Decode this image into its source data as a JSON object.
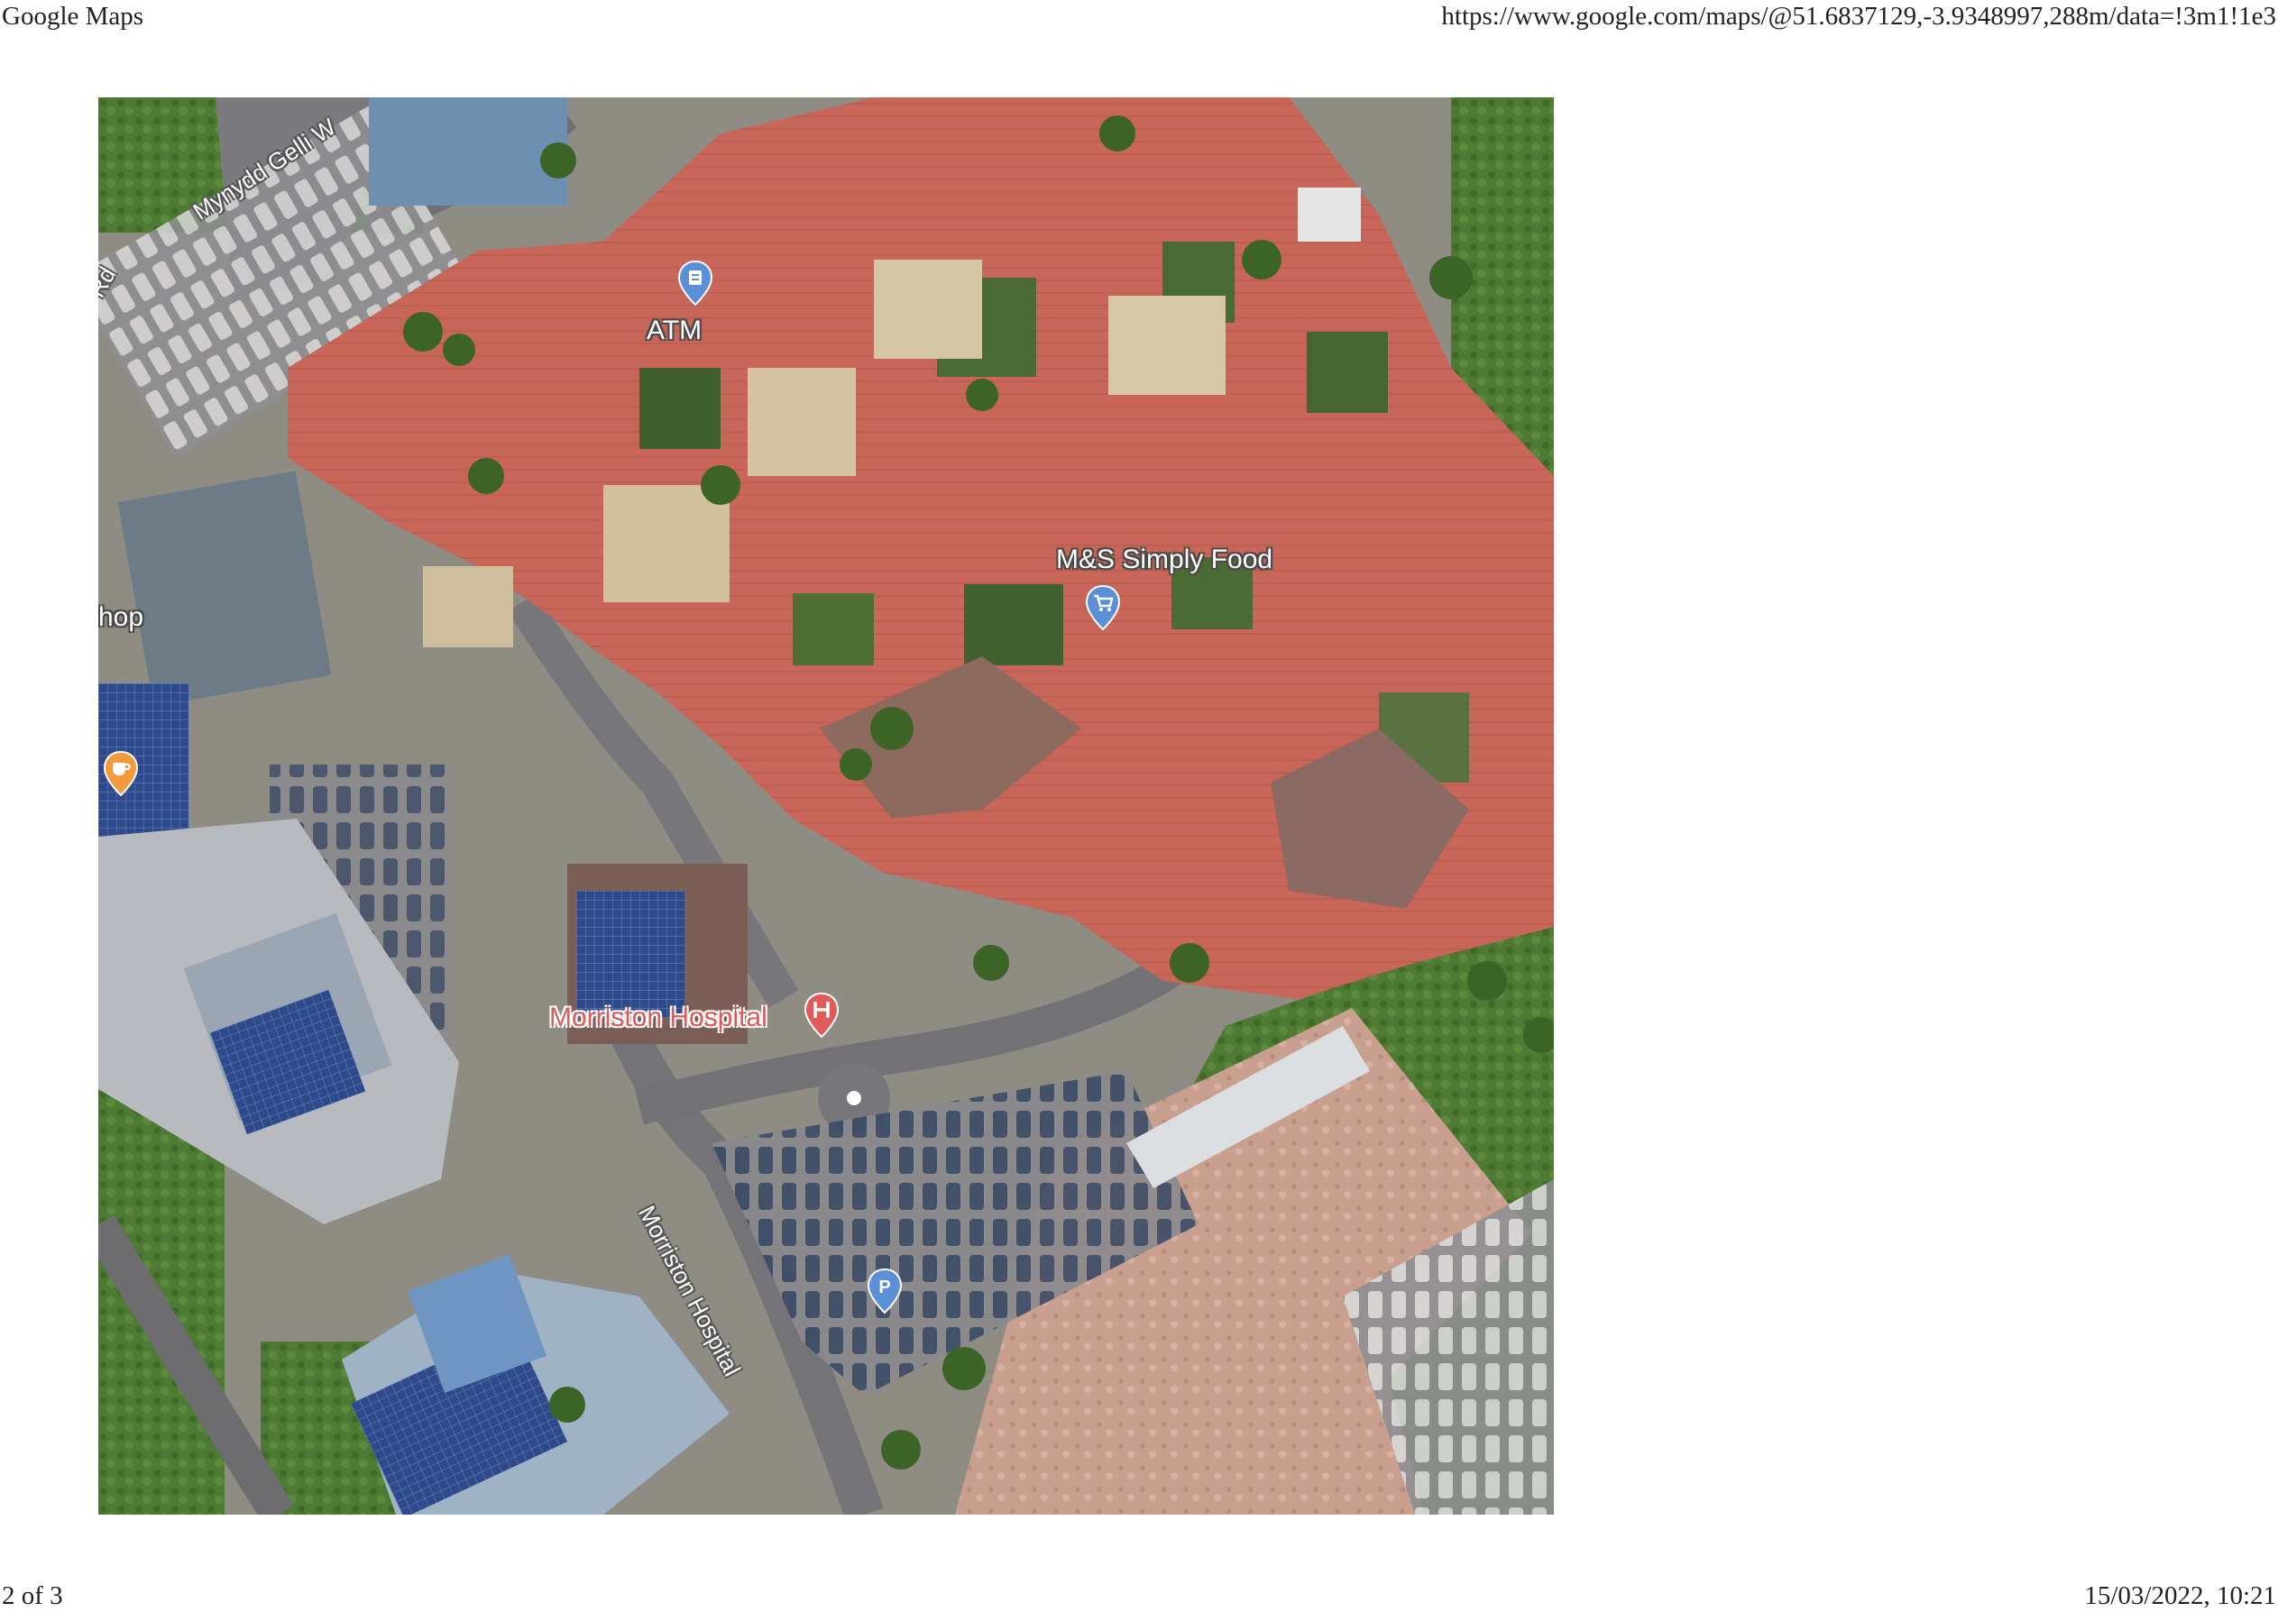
{
  "header": {
    "title": "Google Maps",
    "url": "https://www.google.com/maps/@51.6837129,-3.9348997,288m/data=!3m1!1e3"
  },
  "footer": {
    "page": "2 of 3",
    "datetime": "15/03/2022, 10:21"
  },
  "map": {
    "view": "satellite",
    "labels": {
      "atm": "ATM",
      "store": "M&S Simply Food",
      "hospital": "Morriston Hospital",
      "shop_partial": "hop",
      "road_top": "Mynydd Gelli W",
      "road_top_left": "Rd",
      "road_hospital": "Morriston Hospital"
    },
    "pins": [
      {
        "name": "atm-pin",
        "icon": "atm-icon",
        "color": "#5b8fd6"
      },
      {
        "name": "store-pin",
        "icon": "shopping-cart-icon",
        "color": "#5b8fd6"
      },
      {
        "name": "hospital-pin",
        "icon": "hospital-icon",
        "color": "#e05a5a"
      },
      {
        "name": "cafe-pin",
        "icon": "coffee-icon",
        "color": "#f29a3c"
      },
      {
        "name": "parking-pin",
        "icon": "parking-icon",
        "color": "#5b8fd6"
      }
    ]
  }
}
